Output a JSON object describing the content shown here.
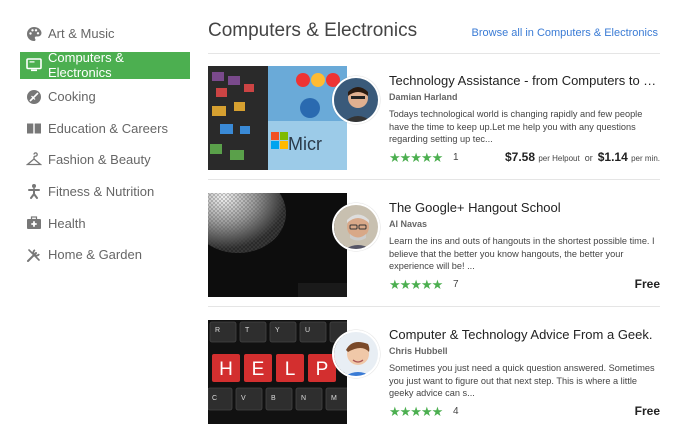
{
  "sidebar": {
    "items": [
      {
        "label": "Art & Music",
        "icon": "palette-icon",
        "active": false
      },
      {
        "label": "Computers & Electronics",
        "icon": "monitor-icon",
        "active": true
      },
      {
        "label": "Cooking",
        "icon": "cooking-icon",
        "active": false
      },
      {
        "label": "Education & Careers",
        "icon": "book-icon",
        "active": false
      },
      {
        "label": "Fashion & Beauty",
        "icon": "hanger-icon",
        "active": false
      },
      {
        "label": "Fitness & Nutrition",
        "icon": "fitness-icon",
        "active": false
      },
      {
        "label": "Health",
        "icon": "medical-kit-icon",
        "active": false
      },
      {
        "label": "Home & Garden",
        "icon": "tools-icon",
        "active": false
      }
    ]
  },
  "main": {
    "title": "Computers & Electronics",
    "browse_all": "Browse all in Computers & Electronics",
    "cards": [
      {
        "title": "Technology Assistance - from Computers to TV'...",
        "expert": "Damian Harland",
        "description": "Todays technological world is changing rapidly and few people have the time  to keep up.Let me help you with any questions regarding setting up tec...",
        "stars": "★★★★★",
        "rating": 5,
        "rating_count": "1",
        "price_a": "$7.58",
        "unit_a": "per Helpout",
        "or": "or",
        "price_b": "$1.14",
        "unit_b": "per min.",
        "thumb_text": "Micr"
      },
      {
        "title": "The Google+ Hangout School",
        "expert": "Al Navas",
        "description": "Learn the ins and outs of hangouts in the shortest possible time. I believe that the better you know hangouts, the better your experience will be! ...",
        "stars": "★★★★★",
        "rating": 5,
        "rating_count": "7",
        "price": "Free"
      },
      {
        "title": "Computer & Technology Advice From a Geek.",
        "expert": "Chris Hubbell",
        "description": "Sometimes you just need a quick question answered. Sometimes you just want to figure out that next step.  This is where a little geeky advice can s...",
        "stars": "★★★★★",
        "rating": 5,
        "rating_count": "4",
        "price": "Free",
        "keys_top": [
          "R",
          "T",
          "Y",
          "U"
        ],
        "keys_mid": [
          "H",
          "E",
          "L",
          "P"
        ],
        "keys_bot": [
          "C",
          "V",
          "B",
          "N",
          "M"
        ]
      }
    ]
  },
  "colors": {
    "accent_green": "#4caf50",
    "link_blue": "#3a7bd5",
    "key_red": "#d32f2f"
  }
}
